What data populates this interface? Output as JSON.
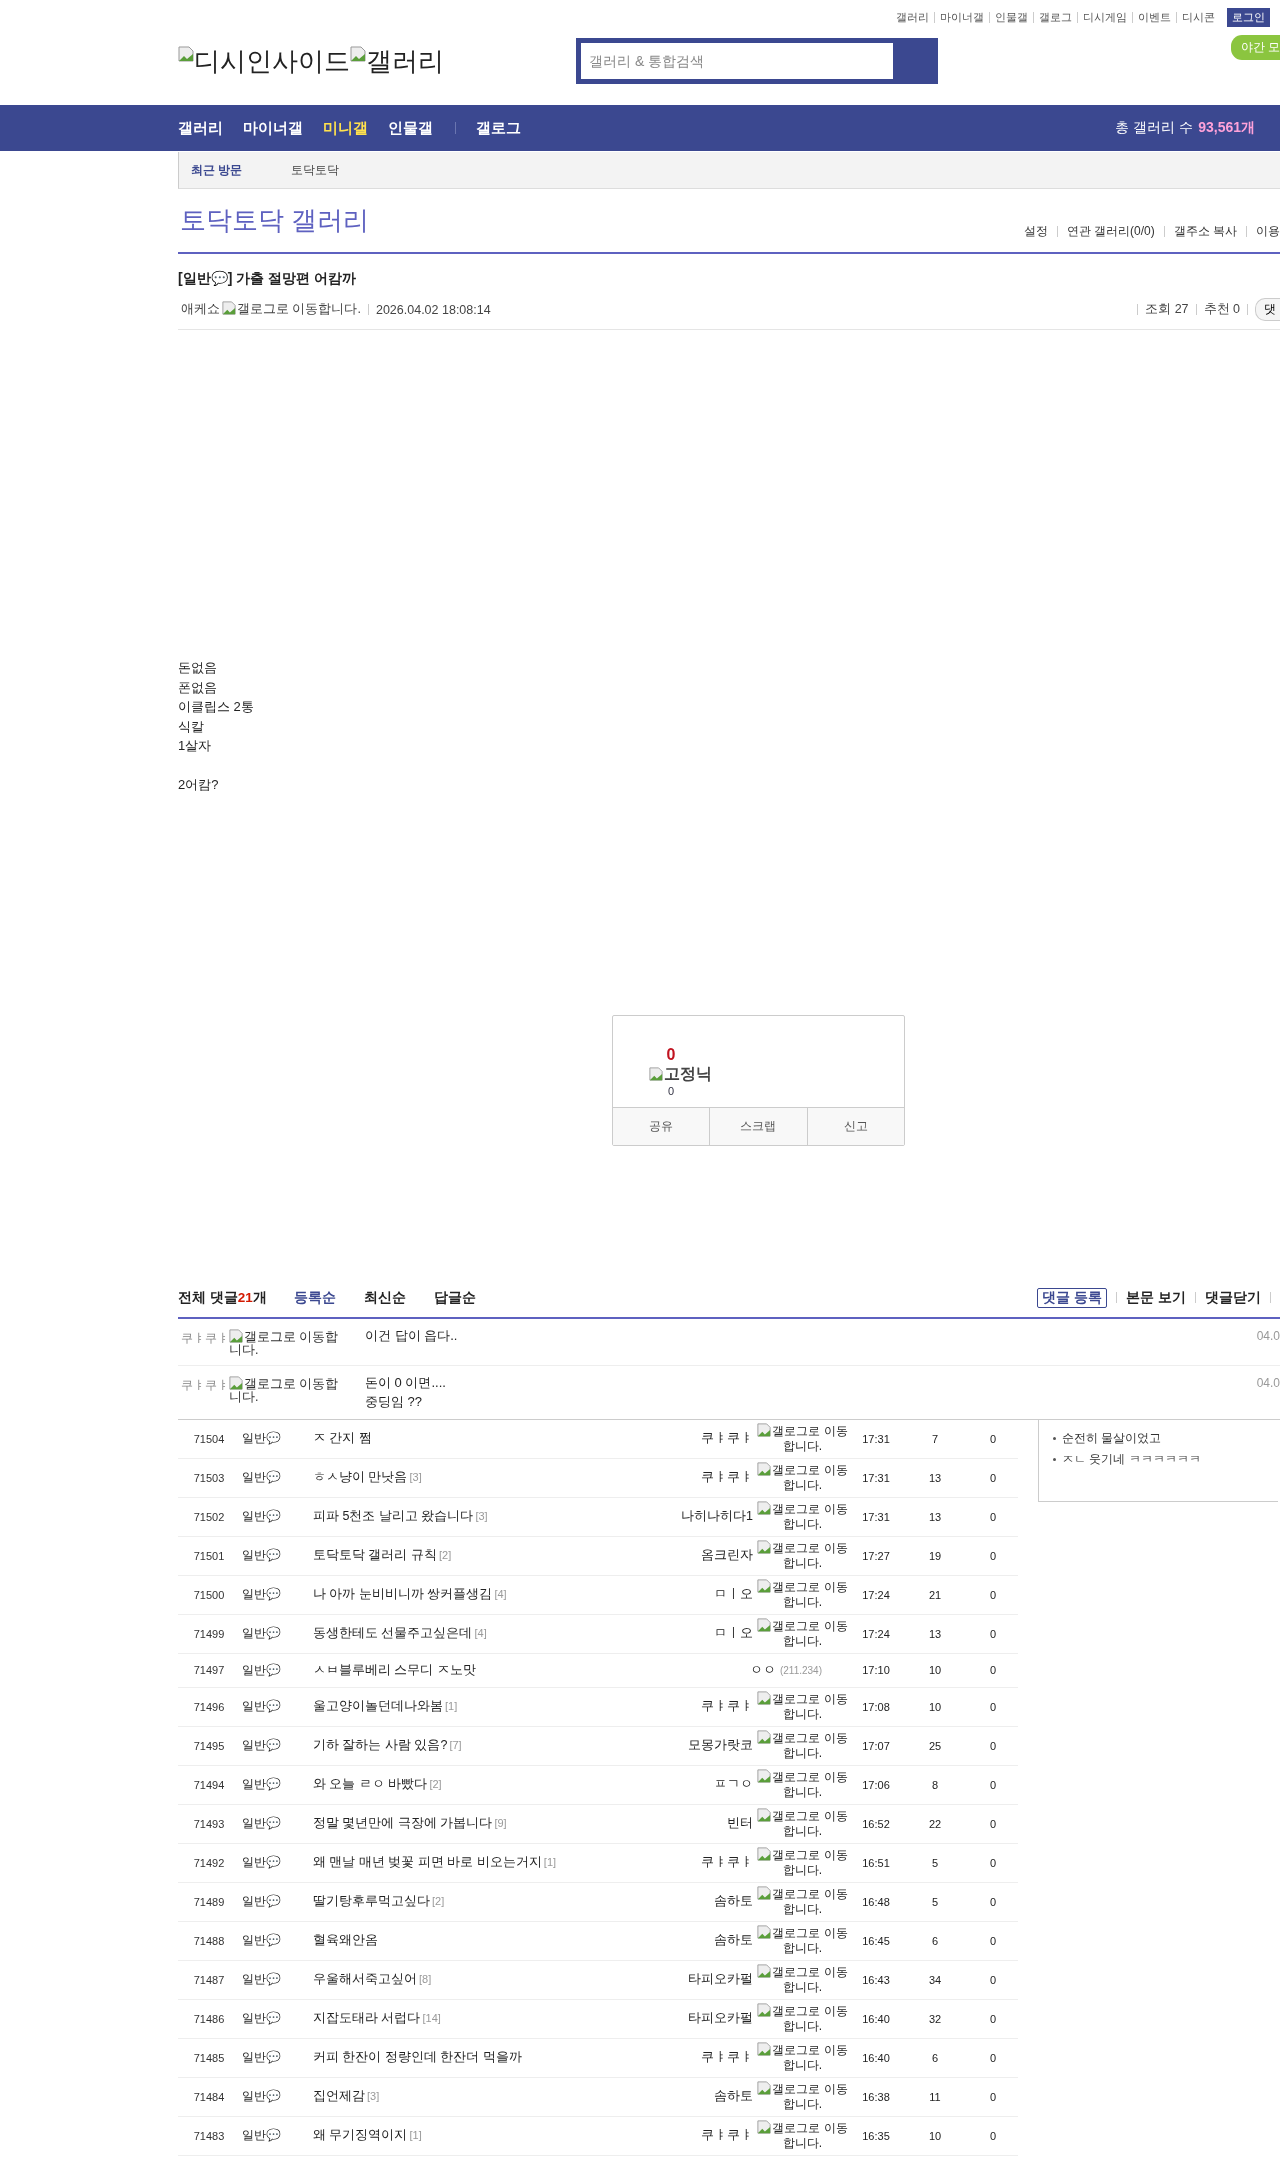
{
  "top_links": [
    "갤러리",
    "마이너갤",
    "인물갤",
    "갤로그",
    "디시게임",
    "이벤트",
    "디시콘"
  ],
  "login": "로그인",
  "night_mode": "야간 모",
  "logo": {
    "site": "디시인사이드",
    "section": "갤러리"
  },
  "search": {
    "placeholder": "갤러리 & 통합검색"
  },
  "nav": [
    {
      "label": "갤러리",
      "selected": false
    },
    {
      "label": "마이너갤",
      "selected": false
    },
    {
      "label": "미니갤",
      "selected": true
    },
    {
      "label": "인물갤",
      "selected": false
    },
    {
      "label": "갤로그",
      "selected": false
    }
  ],
  "gallery_count": {
    "label": "총 갤러리 수",
    "value": "93,561개"
  },
  "recent": {
    "label": "최근 방문",
    "items": [
      "토닥토닥"
    ]
  },
  "gallery_title": "토닥토닥 갤러리",
  "gallery_menu": [
    "설정",
    "연관 갤러리(0/0)",
    "갤주소 복사",
    "이용"
  ],
  "post": {
    "title": "[일반💬] 가출 절망편 어캄까",
    "writer": "애케쇼",
    "gallog": "갤로그로 이동합니다.",
    "date": "2026.04.02 18:08:14",
    "views": "조회 27",
    "recommend": "추천 0",
    "cut_button": "댓",
    "paragraphs": [
      [
        "돈없음",
        "폰없음",
        "이클립스 2통",
        "식칼",
        "1살자"
      ],
      [
        "2어캄?"
      ]
    ]
  },
  "vote": {
    "up": "0",
    "fixed_label": "고정닉",
    "fixed_count": "0",
    "actions": [
      "공유",
      "스크랩",
      "신고"
    ]
  },
  "comments": {
    "label": "전체 댓글",
    "count": "21",
    "unit": "개",
    "sorts": [
      {
        "label": "등록순",
        "selected": true
      },
      {
        "label": "최신순",
        "selected": false
      },
      {
        "label": "답글순",
        "selected": false
      }
    ],
    "actions": [
      {
        "label": "댓글 등록",
        "kind": "boxed"
      },
      {
        "label": "본문 보기",
        "kind": "plain"
      },
      {
        "label": "댓글닫기",
        "kind": "plain"
      }
    ],
    "items": [
      {
        "writer": "쿠ㅑ쿠ㅑ",
        "gallog": "갤로그로 이동합니다.",
        "lines": [
          "이건 답이 읍다.."
        ],
        "date": "04.0"
      },
      {
        "writer": "쿠ㅑ쿠ㅑ",
        "gallog": "갤로그로 이동합니다.",
        "lines": [
          "돈이 0 이면....",
          "중딩임 ??"
        ],
        "date": "04.0"
      }
    ]
  },
  "side_list": [
    "순전히 물살이었고",
    "ㅈㄴ 웃기네 ㅋㅋㅋㅋㅋㅋ"
  ],
  "rows": [
    {
      "num": "71504",
      "type": "일반💬",
      "title": "ㅈ 간지 쩜",
      "replies": "",
      "writer": "쿠ㅑ쿠ㅑ",
      "kind": "member",
      "note": "갤로그로 이동합니다.",
      "time": "17:31",
      "views": "7",
      "recs": "0"
    },
    {
      "num": "71503",
      "type": "일반💬",
      "title": "ㅎㅅ냥이 만낫음",
      "replies": "[3]",
      "writer": "쿠ㅑ쿠ㅑ",
      "kind": "member",
      "note": "갤로그로 이동합니다.",
      "time": "17:31",
      "views": "13",
      "recs": "0"
    },
    {
      "num": "71502",
      "type": "일반💬",
      "title": "피파 5천조 날리고 왔습니다",
      "replies": "[3]",
      "writer": "나히나히다1",
      "kind": "member",
      "note": "갤로그로 이동합니다.",
      "time": "17:31",
      "views": "13",
      "recs": "0"
    },
    {
      "num": "71501",
      "type": "일반💬",
      "title": "토닥토닥 갤러리 규칙",
      "replies": "[2]",
      "writer": "옴크린자",
      "kind": "member",
      "note": "갤로그로 이동합니다.",
      "time": "17:27",
      "views": "19",
      "recs": "0"
    },
    {
      "num": "71500",
      "type": "일반💬",
      "title": "나 아까 눈비비니까 쌍커플생김",
      "replies": "[4]",
      "writer": "ㅁㅣ오",
      "kind": "member",
      "note": "갤로그로 이동합니다.",
      "time": "17:24",
      "views": "21",
      "recs": "0"
    },
    {
      "num": "71499",
      "type": "일반💬",
      "title": "동생한테도 선물주고싶은데",
      "replies": "[4]",
      "writer": "ㅁㅣ오",
      "kind": "member",
      "note": "갤로그로 이동합니다.",
      "time": "17:24",
      "views": "13",
      "recs": "0"
    },
    {
      "num": "71497",
      "type": "일반💬",
      "title": "ㅅㅂ블루베리 스무디 ㅈ노맛",
      "replies": "",
      "writer": "ㅇㅇ",
      "kind": "guest",
      "note": "(211.234)",
      "time": "17:10",
      "views": "10",
      "recs": "0"
    },
    {
      "num": "71496",
      "type": "일반💬",
      "title": "울고양이놀던데나와봄",
      "replies": "[1]",
      "writer": "쿠ㅑ쿠ㅑ",
      "kind": "member",
      "note": "갤로그로 이동합니다.",
      "time": "17:08",
      "views": "10",
      "recs": "0"
    },
    {
      "num": "71495",
      "type": "일반💬",
      "title": "기하 잘하는 사람 있음?",
      "replies": "[7]",
      "writer": "모몽가랏코",
      "kind": "member",
      "note": "갤로그로 이동합니다.",
      "time": "17:07",
      "views": "25",
      "recs": "0"
    },
    {
      "num": "71494",
      "type": "일반💬",
      "title": "와 오늘 ㄹㅇ 바빴다",
      "replies": "[2]",
      "writer": "ㅍㄱㅇ",
      "kind": "member",
      "note": "갤로그로 이동합니다.",
      "time": "17:06",
      "views": "8",
      "recs": "0"
    },
    {
      "num": "71493",
      "type": "일반💬",
      "title": "정말 몇년만에 극장에 가봅니다",
      "replies": "[9]",
      "writer": "빈터",
      "kind": "member",
      "note": "갤로그로 이동합니다.",
      "time": "16:52",
      "views": "22",
      "recs": "0"
    },
    {
      "num": "71492",
      "type": "일반💬",
      "title": "왜 맨날 매년 벚꽃 피면 바로 비오는거지",
      "replies": "[1]",
      "writer": "쿠ㅑ쿠ㅑ",
      "kind": "member",
      "note": "갤로그로 이동합니다.",
      "time": "16:51",
      "views": "5",
      "recs": "0"
    },
    {
      "num": "71489",
      "type": "일반💬",
      "title": "딸기탕후루먹고싶다",
      "replies": "[2]",
      "writer": "솜하토",
      "kind": "member",
      "note": "갤로그로 이동합니다.",
      "time": "16:48",
      "views": "5",
      "recs": "0"
    },
    {
      "num": "71488",
      "type": "일반💬",
      "title": "혈육왜안옴",
      "replies": "",
      "writer": "솜하토",
      "kind": "member",
      "note": "갤로그로 이동합니다.",
      "time": "16:45",
      "views": "6",
      "recs": "0"
    },
    {
      "num": "71487",
      "type": "일반💬",
      "title": "우울해서죽고싶어",
      "replies": "[8]",
      "writer": "타피오카펄",
      "kind": "member",
      "note": "갤로그로 이동합니다.",
      "time": "16:43",
      "views": "34",
      "recs": "0"
    },
    {
      "num": "71486",
      "type": "일반💬",
      "title": "지잡도태라 서럽다",
      "replies": "[14]",
      "writer": "타피오카펄",
      "kind": "member",
      "note": "갤로그로 이동합니다.",
      "time": "16:40",
      "views": "32",
      "recs": "0"
    },
    {
      "num": "71485",
      "type": "일반💬",
      "title": "커피 한잔이 정량인데 한잔더 먹을까",
      "replies": "",
      "writer": "쿠ㅑ쿠ㅑ",
      "kind": "member",
      "note": "갤로그로 이동합니다.",
      "time": "16:40",
      "views": "6",
      "recs": "0"
    },
    {
      "num": "71484",
      "type": "일반💬",
      "title": "집언제감",
      "replies": "[3]",
      "writer": "솜하토",
      "kind": "member",
      "note": "갤로그로 이동합니다.",
      "time": "16:38",
      "views": "11",
      "recs": "0"
    },
    {
      "num": "71483",
      "type": "일반💬",
      "title": "왜 무기징역이지",
      "replies": "[1]",
      "writer": "쿠ㅑ쿠ㅑ",
      "kind": "member",
      "note": "갤로그로 이동합니다.",
      "time": "16:35",
      "views": "10",
      "recs": "0"
    }
  ]
}
